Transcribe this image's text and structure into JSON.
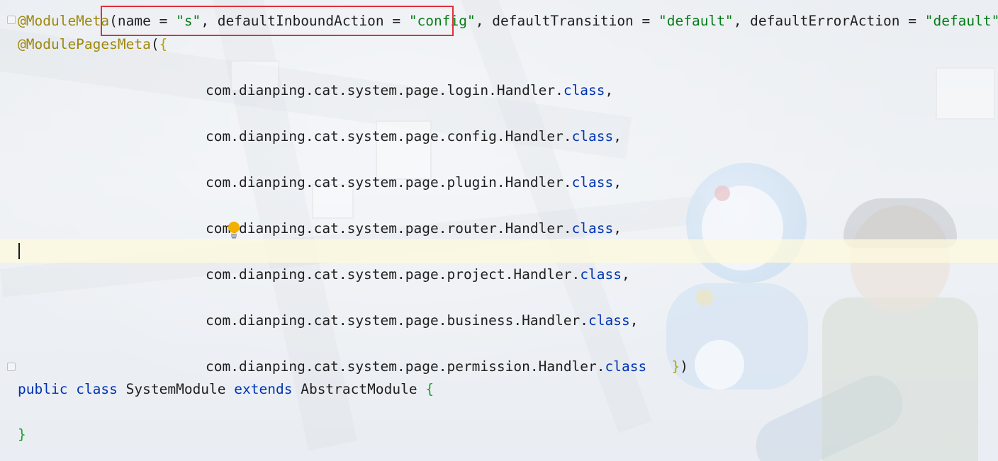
{
  "editor": {
    "lines": [
      {
        "id": "module-meta",
        "segments": [
          {
            "text": "@ModuleMeta",
            "style": "ann"
          },
          {
            "text": "(",
            "style": "plain"
          },
          {
            "text": "name = ",
            "style": "plain"
          },
          {
            "text": "\"s\"",
            "style": "str"
          },
          {
            "text": ", defaultInboundAction = ",
            "style": "plain"
          },
          {
            "text": "\"config\"",
            "style": "str"
          },
          {
            "text": ", defaultTransition = ",
            "style": "plain"
          },
          {
            "text": "\"default\"",
            "style": "str"
          },
          {
            "text": ", defaultErrorAction = ",
            "style": "plain"
          },
          {
            "text": "\"default\"",
            "style": "str"
          },
          {
            "text": ")",
            "style": "plain"
          }
        ]
      },
      {
        "id": "module-pages-meta",
        "segments": [
          {
            "text": "@ModulePagesMeta",
            "style": "ann"
          },
          {
            "text": "(",
            "style": "plain"
          },
          {
            "text": "{",
            "style": "brace-y"
          }
        ]
      },
      {
        "id": "handler-login",
        "segments": [
          {
            "text": "com.dianping.cat.system.page.login.Handler.",
            "style": "plain"
          },
          {
            "text": "class",
            "style": "kw"
          },
          {
            "text": ",",
            "style": "plain"
          }
        ]
      },
      {
        "id": "handler-config",
        "segments": [
          {
            "text": "com.dianping.cat.system.page.config.Handler.",
            "style": "plain"
          },
          {
            "text": "class",
            "style": "kw"
          },
          {
            "text": ",",
            "style": "plain"
          }
        ]
      },
      {
        "id": "handler-plugin",
        "segments": [
          {
            "text": "com.dianping.cat.system.page.plugin.Handler.",
            "style": "plain"
          },
          {
            "text": "class",
            "style": "kw"
          },
          {
            "text": ",",
            "style": "plain"
          }
        ]
      },
      {
        "id": "handler-router",
        "segments": [
          {
            "text": "com.dianping.cat.system.page.router.Handler.",
            "style": "plain"
          },
          {
            "text": "class",
            "style": "kw"
          },
          {
            "text": ",",
            "style": "plain"
          }
        ]
      },
      {
        "id": "handler-project",
        "segments": [
          {
            "text": "com.dianping.cat.system.page.project.Handler.",
            "style": "plain"
          },
          {
            "text": "class",
            "style": "kw"
          },
          {
            "text": ",",
            "style": "plain"
          }
        ]
      },
      {
        "id": "handler-business",
        "segments": [
          {
            "text": "com.dianping.cat.system.page.business.Handler.",
            "style": "plain"
          },
          {
            "text": "class",
            "style": "kw"
          },
          {
            "text": ",",
            "style": "plain"
          }
        ]
      },
      {
        "id": "handler-permission",
        "segments": [
          {
            "text": "com.dianping.cat.system.page.permission.Handler.",
            "style": "plain"
          },
          {
            "text": "class",
            "style": "kw"
          },
          {
            "text": "   ",
            "style": "plain"
          },
          {
            "text": "}",
            "style": "brace-y"
          },
          {
            "text": ")",
            "style": "plain"
          }
        ]
      },
      {
        "id": "class-decl",
        "segments": [
          {
            "text": "public",
            "style": "kw"
          },
          {
            "text": " ",
            "style": "plain"
          },
          {
            "text": "class",
            "style": "kw"
          },
          {
            "text": " SystemModule ",
            "style": "plain"
          },
          {
            "text": "extends",
            "style": "kw"
          },
          {
            "text": " AbstractModule ",
            "style": "plain"
          },
          {
            "text": "{",
            "style": "brace-g"
          }
        ]
      },
      {
        "id": "class-close",
        "segments": [
          {
            "text": "}",
            "style": "brace-g"
          }
        ]
      }
    ]
  },
  "colors": {
    "annotation": "#9e880d",
    "string": "#067d17",
    "keyword": "#0033b3",
    "highlight_box": "#e0303a",
    "current_line": "#fdfadc"
  },
  "icons": {
    "intention_bulb": "lightbulb-icon"
  }
}
